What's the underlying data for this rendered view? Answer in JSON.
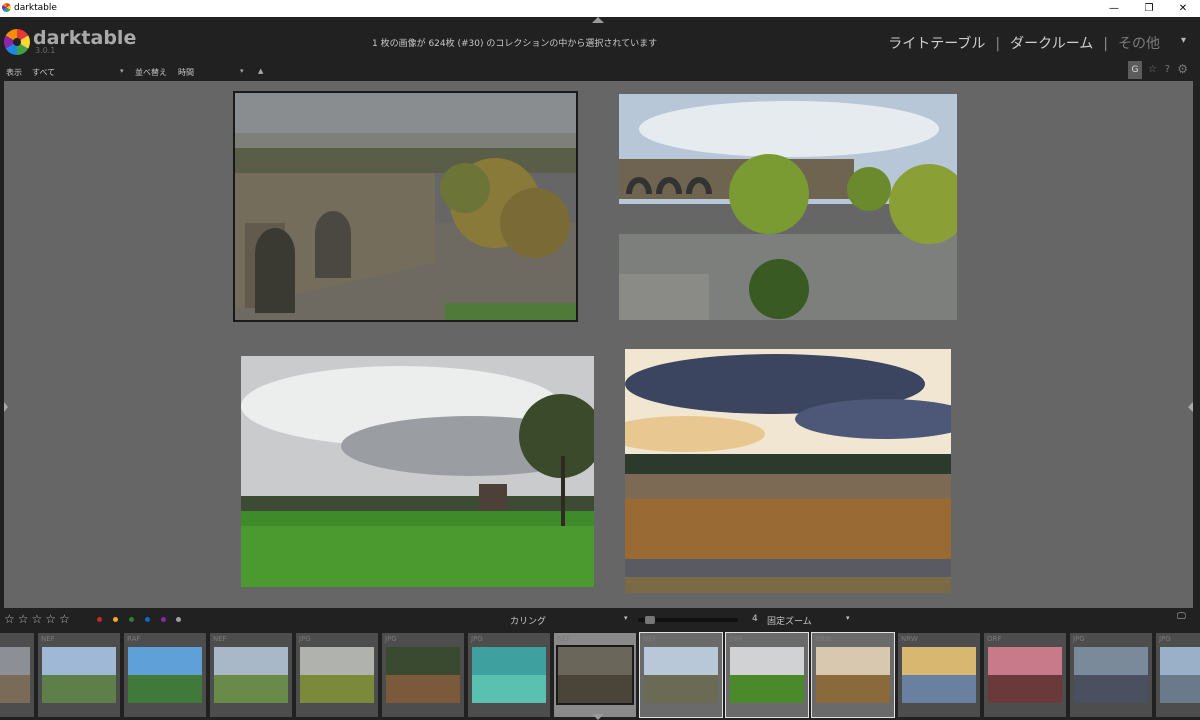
{
  "window": {
    "title": "darktable",
    "minimize": "—",
    "restore": "❐",
    "close": "✕"
  },
  "header": {
    "logo_text": "darktable",
    "version": "3.0.1",
    "message": "1 枚の画像が 624枚 (#30) のコレクションの中から選択されています",
    "views": {
      "lighttable": "ライトテーブル",
      "darkroom": "ダークルーム",
      "other": "その他",
      "separator": "|"
    }
  },
  "filterbar": {
    "display_label": "表示",
    "display_value": "すべて",
    "sort_label": "並べ替え",
    "sort_value": "時間",
    "sort_direction": "▲",
    "dropdown_arrow": "▾",
    "grouping_label": "G",
    "star_icon": "☆",
    "help_icon": "?",
    "settings_icon": "⚙"
  },
  "bottombar": {
    "stars": "☆☆☆☆☆",
    "color_labels": [
      "#c62828",
      "#f9a825",
      "#2e7d32",
      "#1565c0",
      "#8e24aa",
      "#9e9e9e"
    ],
    "layout_label": "カリング",
    "count": "4",
    "zoom_label": "固定ズーム",
    "zoom_fraction": 0.12,
    "dropdown_arrow": "▾",
    "monitor_icon": "🖵"
  },
  "filmstrip": {
    "items": [
      {
        "type": ""
      },
      {
        "type": "NEF"
      },
      {
        "type": "RAF"
      },
      {
        "type": "NEF"
      },
      {
        "type": "JPG"
      },
      {
        "type": "JPG"
      },
      {
        "type": "JPG"
      },
      {
        "type": "NEF"
      },
      {
        "type": "NEF"
      },
      {
        "type": "ORF"
      },
      {
        "type": "NRW"
      },
      {
        "type": "NRW"
      },
      {
        "type": "ORF"
      },
      {
        "type": "JPG"
      },
      {
        "type": "JPG"
      }
    ]
  }
}
